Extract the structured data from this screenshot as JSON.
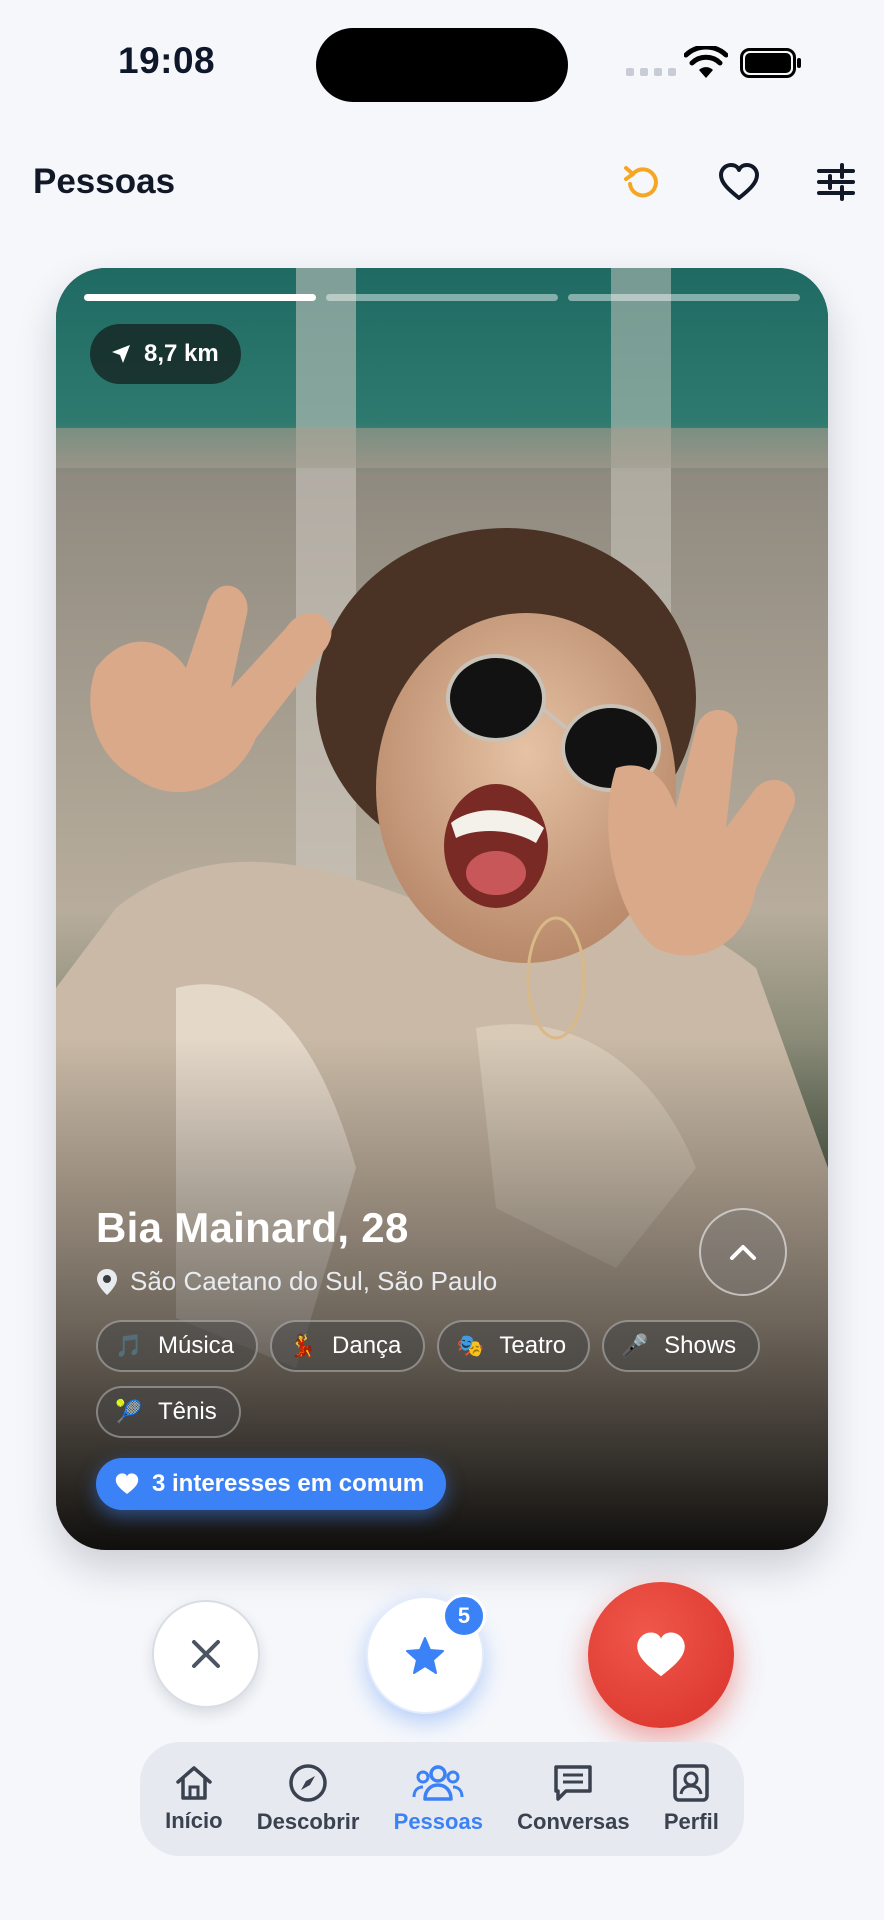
{
  "status_bar": {
    "time": "19:08"
  },
  "header": {
    "title": "Pessoas",
    "accent": "#f5a623"
  },
  "card": {
    "distance": "8,7 km",
    "name": "Bia Mainard, 28",
    "location": "São Caetano do Sul, São Paulo",
    "photos_total": 3,
    "photo_index": 1,
    "tags": [
      {
        "emoji": "🎵",
        "label": "Música"
      },
      {
        "emoji": "💃",
        "label": "Dança"
      },
      {
        "emoji": "🎭",
        "label": "Teatro"
      },
      {
        "emoji": "🎤",
        "label": "Shows"
      },
      {
        "emoji": "🎾",
        "label": "Tênis"
      }
    ],
    "common_interests": "3 interesses em comum"
  },
  "actions": {
    "superlike_count": "5"
  },
  "nav": {
    "items": [
      {
        "label": "Início",
        "icon": "home-icon"
      },
      {
        "label": "Descobrir",
        "icon": "compass-icon"
      },
      {
        "label": "Pessoas",
        "icon": "people-icon",
        "active": true
      },
      {
        "label": "Conversas",
        "icon": "chat-icon"
      },
      {
        "label": "Perfil",
        "icon": "profile-icon"
      }
    ]
  },
  "colors": {
    "primary": "#3b82f6",
    "like": "#e0392f",
    "background": "#f5f7fb"
  }
}
